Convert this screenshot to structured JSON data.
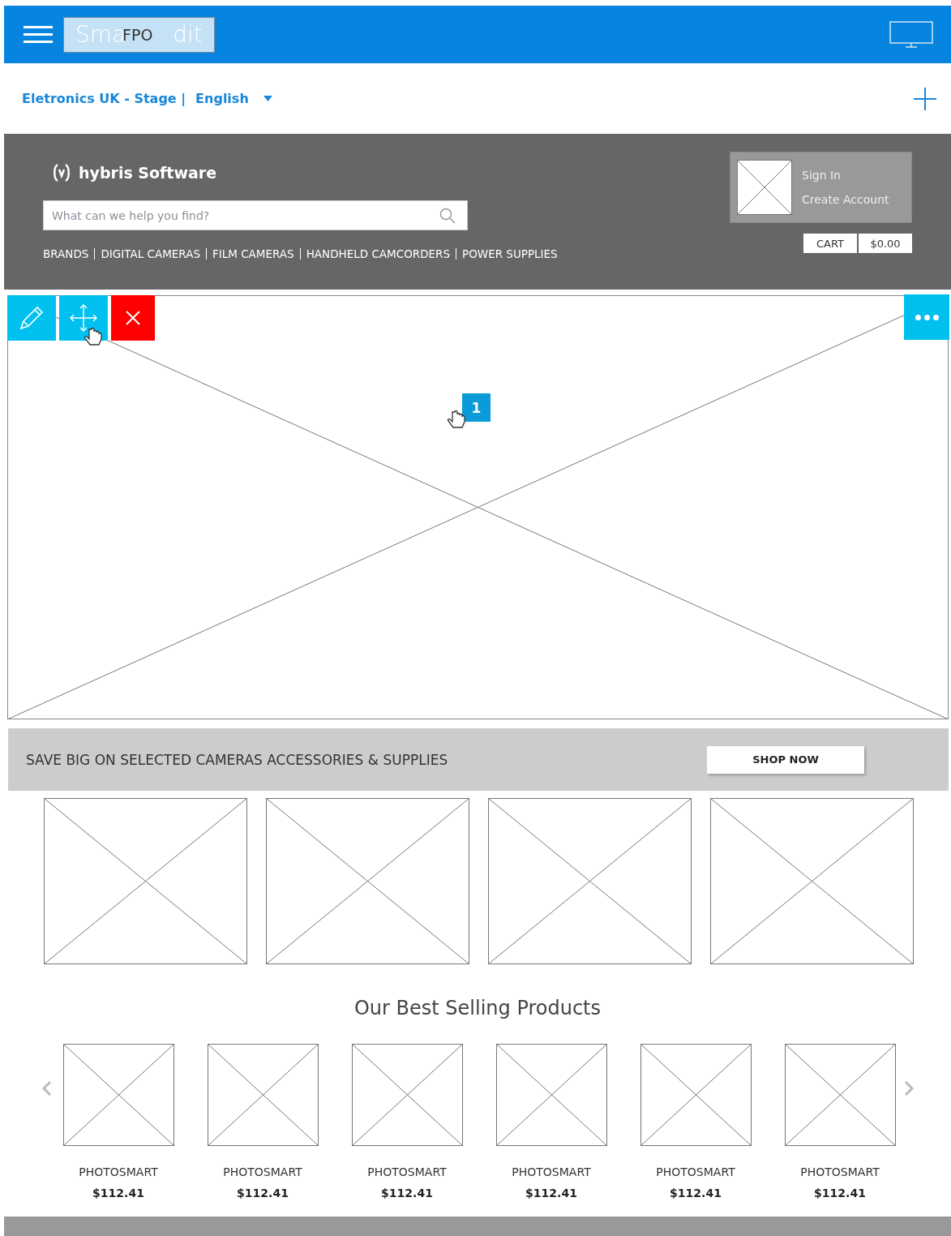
{
  "toolbar": {
    "logo": {
      "parts": [
        "Sma",
        "dit"
      ],
      "overlay": "FPO"
    }
  },
  "context": {
    "catalog": "Eletronics UK - Stage |",
    "language": "English"
  },
  "site": {
    "brand": "hybris Software",
    "search": {
      "placeholder": "What can we help you find?"
    },
    "nav": [
      "BRANDS",
      "DIGITAL CAMERAS",
      "FILM CAMERAS",
      "HANDHELD CAMCORDERS",
      "POWER SUPPLIES"
    ],
    "account": [
      "Sign In",
      "Create Account"
    ],
    "cart": {
      "label": "CART",
      "total": "$0.00"
    }
  },
  "hero": {
    "badge": "1"
  },
  "promo": {
    "text": "SAVE BIG ON SELECTED CAMERAS ACCESSORIES & SUPPLIES",
    "button": "SHOP NOW"
  },
  "tiles": [
    {
      "kind": "placeholder"
    },
    {
      "kind": "placeholder"
    },
    {
      "kind": "placeholder"
    },
    {
      "kind": "placeholder"
    }
  ],
  "best_sellers": {
    "title": "Our Best Selling Products",
    "products": [
      {
        "name": "PHOTOSMART",
        "price": "$112.41"
      },
      {
        "name": "PHOTOSMART",
        "price": "$112.41"
      },
      {
        "name": "PHOTOSMART",
        "price": "$112.41"
      },
      {
        "name": "PHOTOSMART",
        "price": "$112.41"
      },
      {
        "name": "PHOTOSMART",
        "price": "$112.41"
      },
      {
        "name": "PHOTOSMART",
        "price": "$112.41"
      }
    ]
  }
}
